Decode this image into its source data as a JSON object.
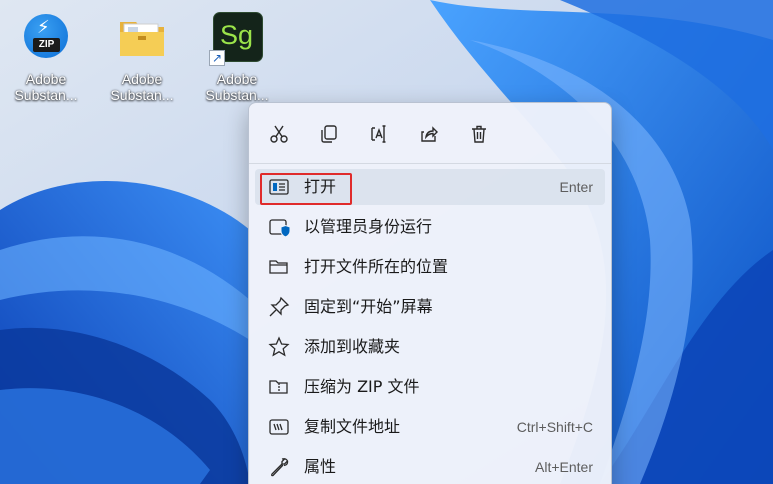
{
  "desktop": {
    "icons": [
      {
        "line1": "Adobe",
        "line2": "Substan...",
        "icon": "zip-icon",
        "badge": "ZIP"
      },
      {
        "line1": "Adobe",
        "line2": "Substan...",
        "icon": "folder-icon"
      },
      {
        "line1": "Adobe",
        "line2": "Substan...",
        "icon": "substance-sampler-icon",
        "badge": "Sg"
      }
    ]
  },
  "context_menu": {
    "toolbar": [
      {
        "name": "cut",
        "icon": "scissors-icon"
      },
      {
        "name": "copy",
        "icon": "copy-icon"
      },
      {
        "name": "rename",
        "icon": "rename-icon"
      },
      {
        "name": "share",
        "icon": "share-icon"
      },
      {
        "name": "delete",
        "icon": "trash-icon"
      }
    ],
    "items": [
      {
        "label": "打开",
        "shortcut": "Enter",
        "icon": "app-window-icon"
      },
      {
        "label": "以管理员身份运行",
        "shortcut": "",
        "icon": "shield-icon"
      },
      {
        "label": "打开文件所在的位置",
        "shortcut": "",
        "icon": "folder-open-icon"
      },
      {
        "label": "固定到“开始”屏幕",
        "shortcut": "",
        "icon": "pin-icon"
      },
      {
        "label": "添加到收藏夹",
        "shortcut": "",
        "icon": "star-icon"
      },
      {
        "label": "压缩为 ZIP 文件",
        "shortcut": "",
        "icon": "zip-folder-icon"
      },
      {
        "label": "复制文件地址",
        "shortcut": "Ctrl+Shift+C",
        "icon": "copy-path-icon"
      },
      {
        "label": "属性",
        "shortcut": "Alt+Enter",
        "icon": "wrench-icon"
      }
    ]
  },
  "colors": {
    "accent": "#0067c0",
    "highlight_border": "#e02b2b",
    "menu_background": "#eef2fa"
  }
}
